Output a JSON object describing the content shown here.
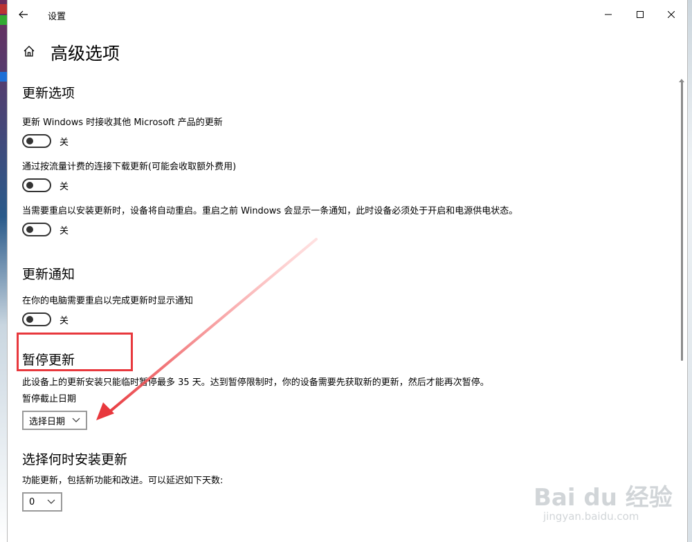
{
  "window": {
    "title": "设置",
    "controls": {
      "minimize": "minimize",
      "maximize": "maximize",
      "close": "close"
    }
  },
  "page": {
    "title": "高级选项"
  },
  "update_options": {
    "title": "更新选项",
    "items": [
      {
        "label": "更新 Windows 时接收其他 Microsoft 产品的更新",
        "state": "关"
      },
      {
        "label": "通过按流量计费的连接下载更新(可能会收取额外费用)",
        "state": "关"
      },
      {
        "label": "当需要重启以安装更新时，设备将自动重启。重启之前 Windows 会显示一条通知，此时设备必须处于开启和电源供电状态。",
        "state": "关"
      }
    ]
  },
  "update_notifications": {
    "title": "更新通知",
    "items": [
      {
        "label": "在你的电脑需要重启以完成更新时显示通知",
        "state": "关"
      }
    ]
  },
  "pause_updates": {
    "title": "暂停更新",
    "description": "此设备上的更新安装只能临时暂停最多 35 天。达到暂停限制时，你的设备需要先获取新的更新，然后才能再次暂停。",
    "date_label": "暂停截止日期",
    "date_select": "选择日期"
  },
  "install_timing": {
    "title": "选择何时安装更新",
    "feature_label": "功能更新，包括新功能和改进。可以延迟如下天数:",
    "feature_select": "0"
  },
  "watermark": {
    "main": "Bai du 经验",
    "sub": "jingyan.baidu.com"
  },
  "colors": {
    "highlight": "#e8383d",
    "toggle_border": "#333333",
    "dropdown_border": "#999999"
  }
}
